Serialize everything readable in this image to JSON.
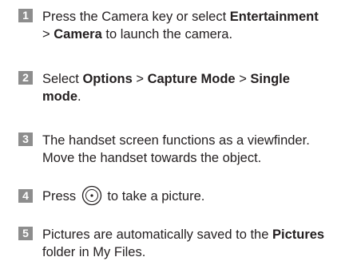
{
  "steps": [
    {
      "number": "1",
      "parts": [
        "Press the Camera key or select ",
        "Entertainment",
        "\n> ",
        "Camera",
        " to launch the camera."
      ]
    },
    {
      "number": "2",
      "parts": [
        "Select ",
        "Options",
        " > ",
        "Capture Mode",
        " > ",
        "Single\nmode",
        "."
      ]
    },
    {
      "number": "3",
      "parts": [
        "The handset screen functions as a viewfinder.",
        "\nMove the handset towards the object."
      ]
    },
    {
      "number": "4",
      "parts": [
        "Press ",
        " to take a picture."
      ],
      "icon": "ok-key-icon"
    },
    {
      "number": "5",
      "parts": [
        "Pictures are automatically saved to the ",
        "Pictures",
        "\nfolder in My Files."
      ]
    }
  ]
}
